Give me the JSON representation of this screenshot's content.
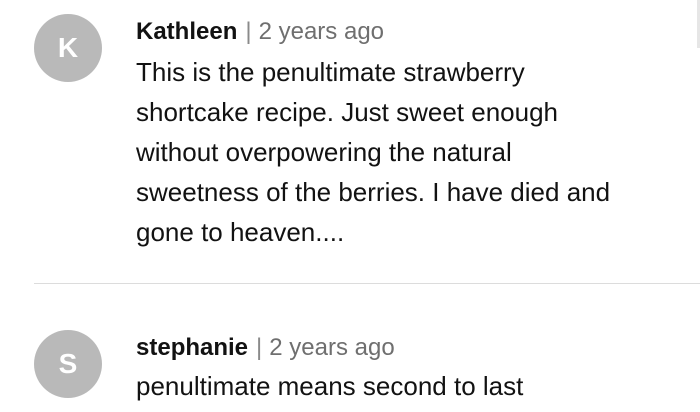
{
  "comments": [
    {
      "avatar_letter": "K",
      "author": "Kathleen",
      "separator": "|",
      "time": "2 years ago",
      "text": "This is the penultimate strawberry shortcake recipe.  Just sweet enough without overpowering the natural sweetness of the berries.  I have died and gone to heaven...."
    },
    {
      "avatar_letter": "S",
      "author": "stephanie",
      "separator": "|",
      "time": "2 years ago",
      "text": "penultimate means second to last"
    }
  ],
  "colors": {
    "avatar_bg": "#b9b9b9",
    "text": "#121212",
    "meta": "#6f6f6f",
    "divider": "#dcdcdc"
  }
}
